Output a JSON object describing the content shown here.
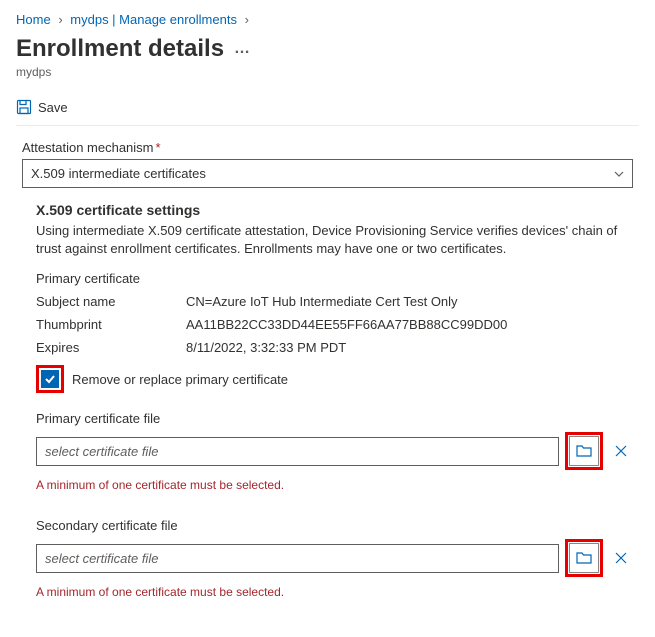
{
  "breadcrumb": {
    "home": "Home",
    "item1": "mydps | Manage enrollments"
  },
  "page": {
    "title": "Enrollment details",
    "subtitle": "mydps"
  },
  "toolbar": {
    "save_label": "Save"
  },
  "form": {
    "attestation_label": "Attestation mechanism",
    "attestation_value": "X.509 intermediate certificates"
  },
  "x509": {
    "section_title": "X.509 certificate settings",
    "section_desc": "Using intermediate X.509 certificate attestation, Device Provisioning Service verifies devices' chain of trust against enrollment certificates. Enrollments may have one or two certificates.",
    "primary_header": "Primary certificate",
    "subject_label": "Subject name",
    "subject_value": "CN=Azure IoT Hub Intermediate Cert Test Only",
    "thumbprint_label": "Thumbprint",
    "thumbprint_value": "AA11BB22CC33DD44EE55FF66AA77BB88CC99DD00",
    "expires_label": "Expires",
    "expires_value": "8/11/2022, 3:32:33 PM PDT",
    "remove_replace_label": "Remove or replace primary certificate",
    "primary_file_label": "Primary certificate file",
    "secondary_file_label": "Secondary certificate file",
    "file_placeholder": "select certificate file",
    "error_text": "A minimum of one certificate must be selected."
  }
}
